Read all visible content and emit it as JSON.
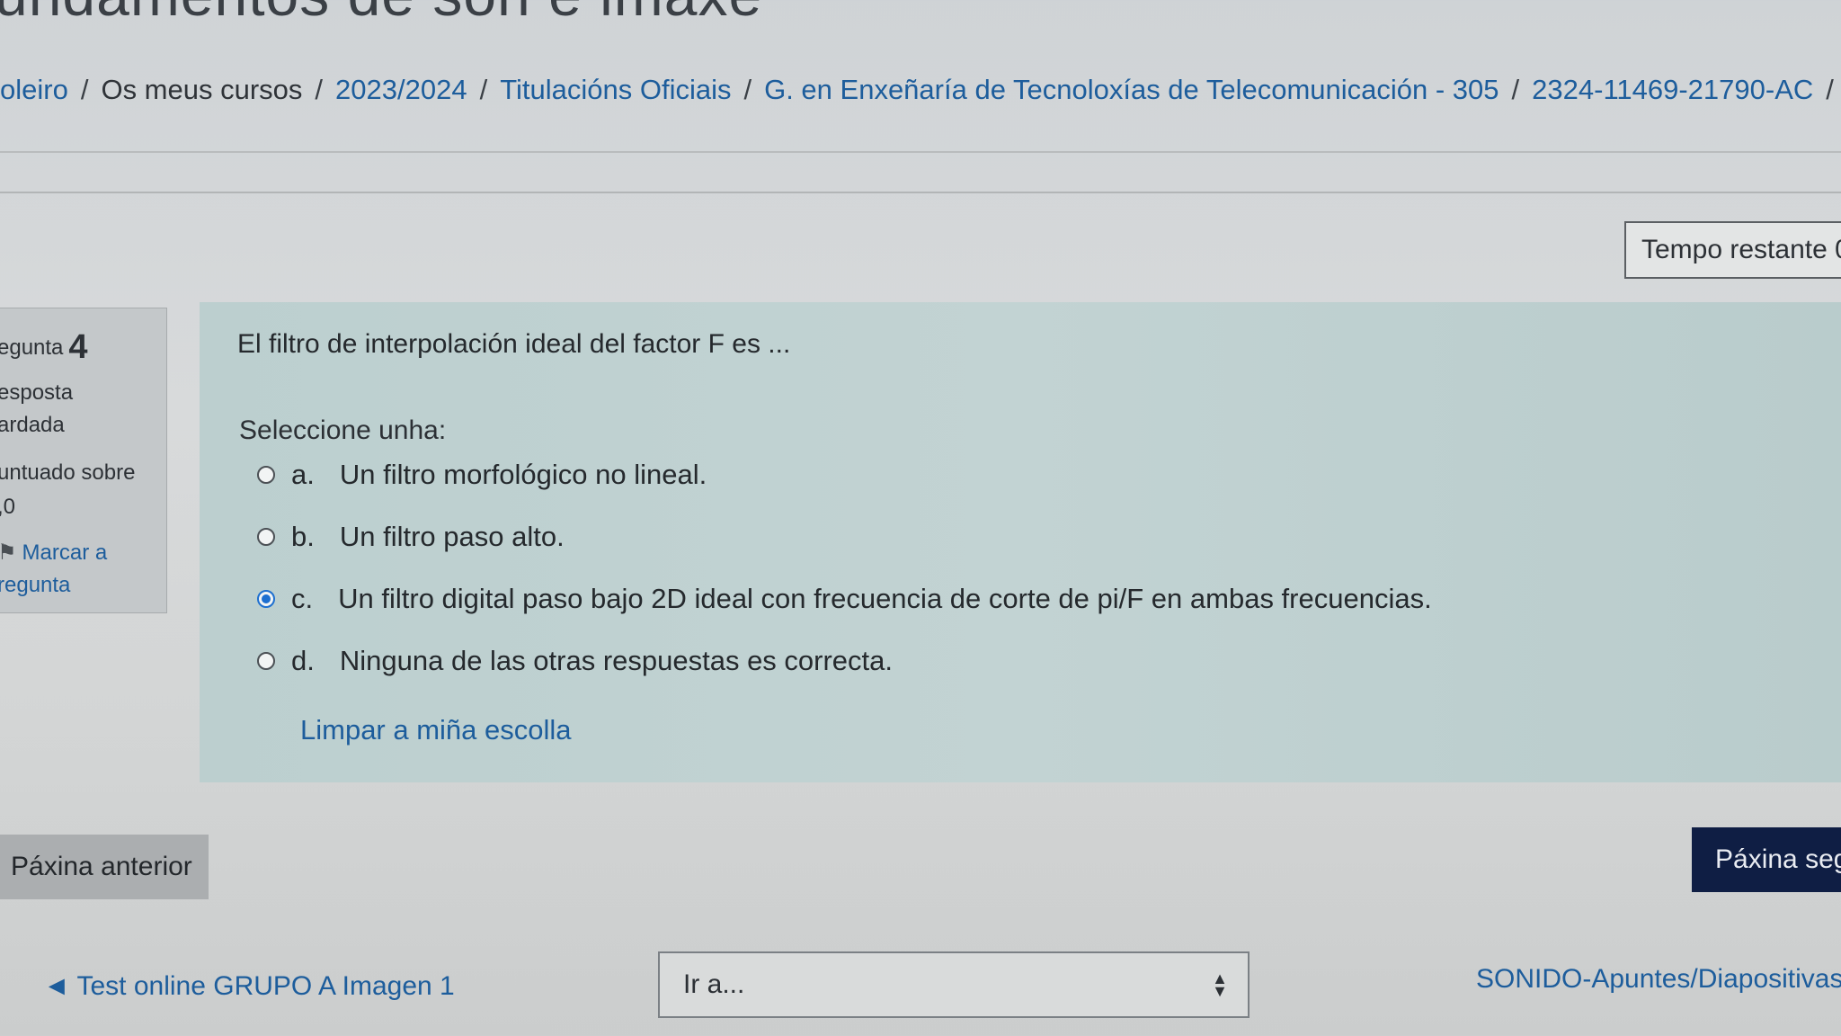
{
  "page": {
    "title": "undamentos de son e imaxe"
  },
  "breadcrumb": [
    {
      "label": "oleiro"
    },
    {
      "label": "Os meus cursos"
    },
    {
      "label": "2023/2024"
    },
    {
      "label": "Titulacións Oficiais"
    },
    {
      "label": "G. en Enxeñaría de Tecnoloxías de Telecomunicación - 305"
    },
    {
      "label": "2324-11469-21790-AC"
    }
  ],
  "timer": {
    "label": "Tempo restante 0"
  },
  "question_info": {
    "label": "egunta",
    "number": "4",
    "state_line1": "esposta",
    "state_line2": "ardada",
    "grade_line1": "untuado sobre",
    "grade_line2": ",0",
    "flag_line1": "Marcar a",
    "flag_line2": "regunta"
  },
  "question": {
    "text": "El filtro de interpolación ideal del factor F es ...",
    "prompt": "Seleccione unha:",
    "answers": [
      {
        "letter": "a.",
        "text": "Un filtro morfológico no lineal.",
        "selected": false
      },
      {
        "letter": "b.",
        "text": "Un filtro paso alto.",
        "selected": false
      },
      {
        "letter": "c.",
        "text": "Un filtro digital paso bajo 2D ideal con frecuencia de corte de pi/F en ambas frecuencias.",
        "selected": true
      },
      {
        "letter": "d.",
        "text": "Ninguna de las otras respuestas es correcta.",
        "selected": false
      }
    ],
    "clear_label": "Limpar a miña escolla"
  },
  "navigation": {
    "prev_label": "Páxina anterior",
    "next_label": "Páxina seg"
  },
  "activity_nav": {
    "prev_activity": "Test online GRUPO A Imagen 1",
    "jump_placeholder": "Ir a...",
    "next_activity": "SONIDO-Apuntes/Diapositivas"
  },
  "colors": {
    "link": "#1d5d9c",
    "primary_button": "#0f1e44",
    "question_bg": "#c2d3d3",
    "radio_checked": "#1d6fd0"
  }
}
